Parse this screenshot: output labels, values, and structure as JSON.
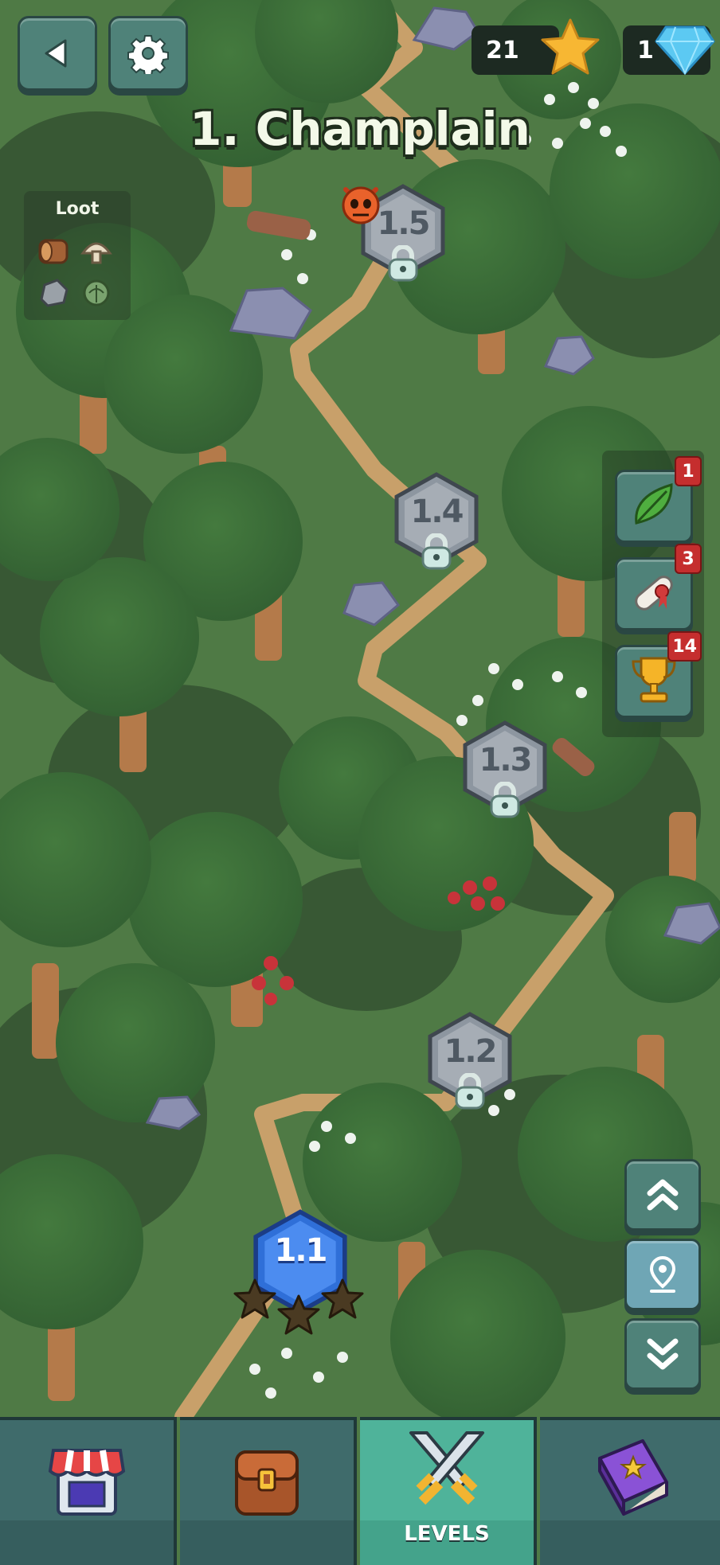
{
  "header": {
    "stars_count": "21",
    "gems_count": "1",
    "title": "1. Champlain"
  },
  "loot": {
    "title": "Loot",
    "items": [
      "wood-log-icon",
      "mushroom-icon",
      "stone-icon",
      "herb-icon"
    ]
  },
  "levels": [
    {
      "label": "1.5",
      "state": "locked"
    },
    {
      "label": "1.4",
      "state": "locked"
    },
    {
      "label": "1.3",
      "state": "locked"
    },
    {
      "label": "1.2",
      "state": "locked"
    },
    {
      "label": "1.1",
      "state": "unlocked",
      "stars_earned": 0,
      "stars_total": 3
    }
  ],
  "side_buttons": [
    {
      "icon": "leaf-icon",
      "badge": "1"
    },
    {
      "icon": "scroll-icon",
      "badge": "3"
    },
    {
      "icon": "trophy-icon",
      "badge": "14"
    }
  ],
  "map_nav": {
    "up_icon": "double-chevron-up-icon",
    "locate_icon": "map-pin-icon",
    "down_icon": "double-chevron-down-icon"
  },
  "tabs": [
    {
      "icon": "shop-icon",
      "label": ""
    },
    {
      "icon": "backpack-icon",
      "label": ""
    },
    {
      "icon": "crossed-swords-icon",
      "label": "LEVELS",
      "active": true
    },
    {
      "icon": "spellbook-icon",
      "label": ""
    }
  ],
  "colors": {
    "grass": "#4f7a45",
    "path": "#c8a06a",
    "tree_canopy": "#3c6a38",
    "ui_teal": "#4f8279",
    "active_tab": "#4fb39a",
    "badge_red": "#c52e2e",
    "level_unlocked": "#2f6fd8",
    "level_locked": "#8d96a0"
  }
}
